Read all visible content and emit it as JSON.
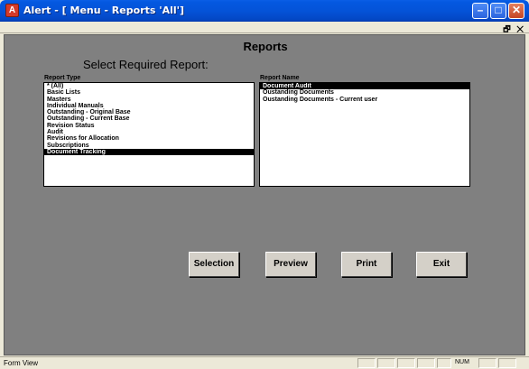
{
  "window": {
    "icon_glyph": "A",
    "title": "Alert - [ Menu - Reports 'All']",
    "minimize_glyph": "–",
    "maximize_glyph": "□",
    "close_glyph": "✕",
    "mdi_controls": "🗗 ✕"
  },
  "form": {
    "title": "Reports",
    "select_label": "Select Required Report:",
    "report_type_label": "Report Type",
    "report_name_label": "Report Name",
    "report_types": [
      "* (All)",
      "Basic Lists",
      "Masters",
      "Individual Manuals",
      "Outstanding - Original Base",
      "Outstanding - Current Base",
      "Revision Status",
      "Audit",
      "Revisions for Allocation",
      "Subscriptions",
      "Document Tracking"
    ],
    "selected_report_type": "Document Tracking",
    "report_names": [
      "Document Audit",
      "Oustanding Documents",
      "Oustanding Documents - Current user"
    ],
    "selected_report_name": "Document Audit"
  },
  "buttons": {
    "selection": "Selection",
    "preview": "Preview",
    "print": "Print",
    "exit": "Exit"
  },
  "statusbar": {
    "view": "Form View",
    "num": "NUM"
  },
  "colors": {
    "titlebar": "#0453d8",
    "form_bg": "#808080",
    "chrome": "#ece9d8"
  }
}
